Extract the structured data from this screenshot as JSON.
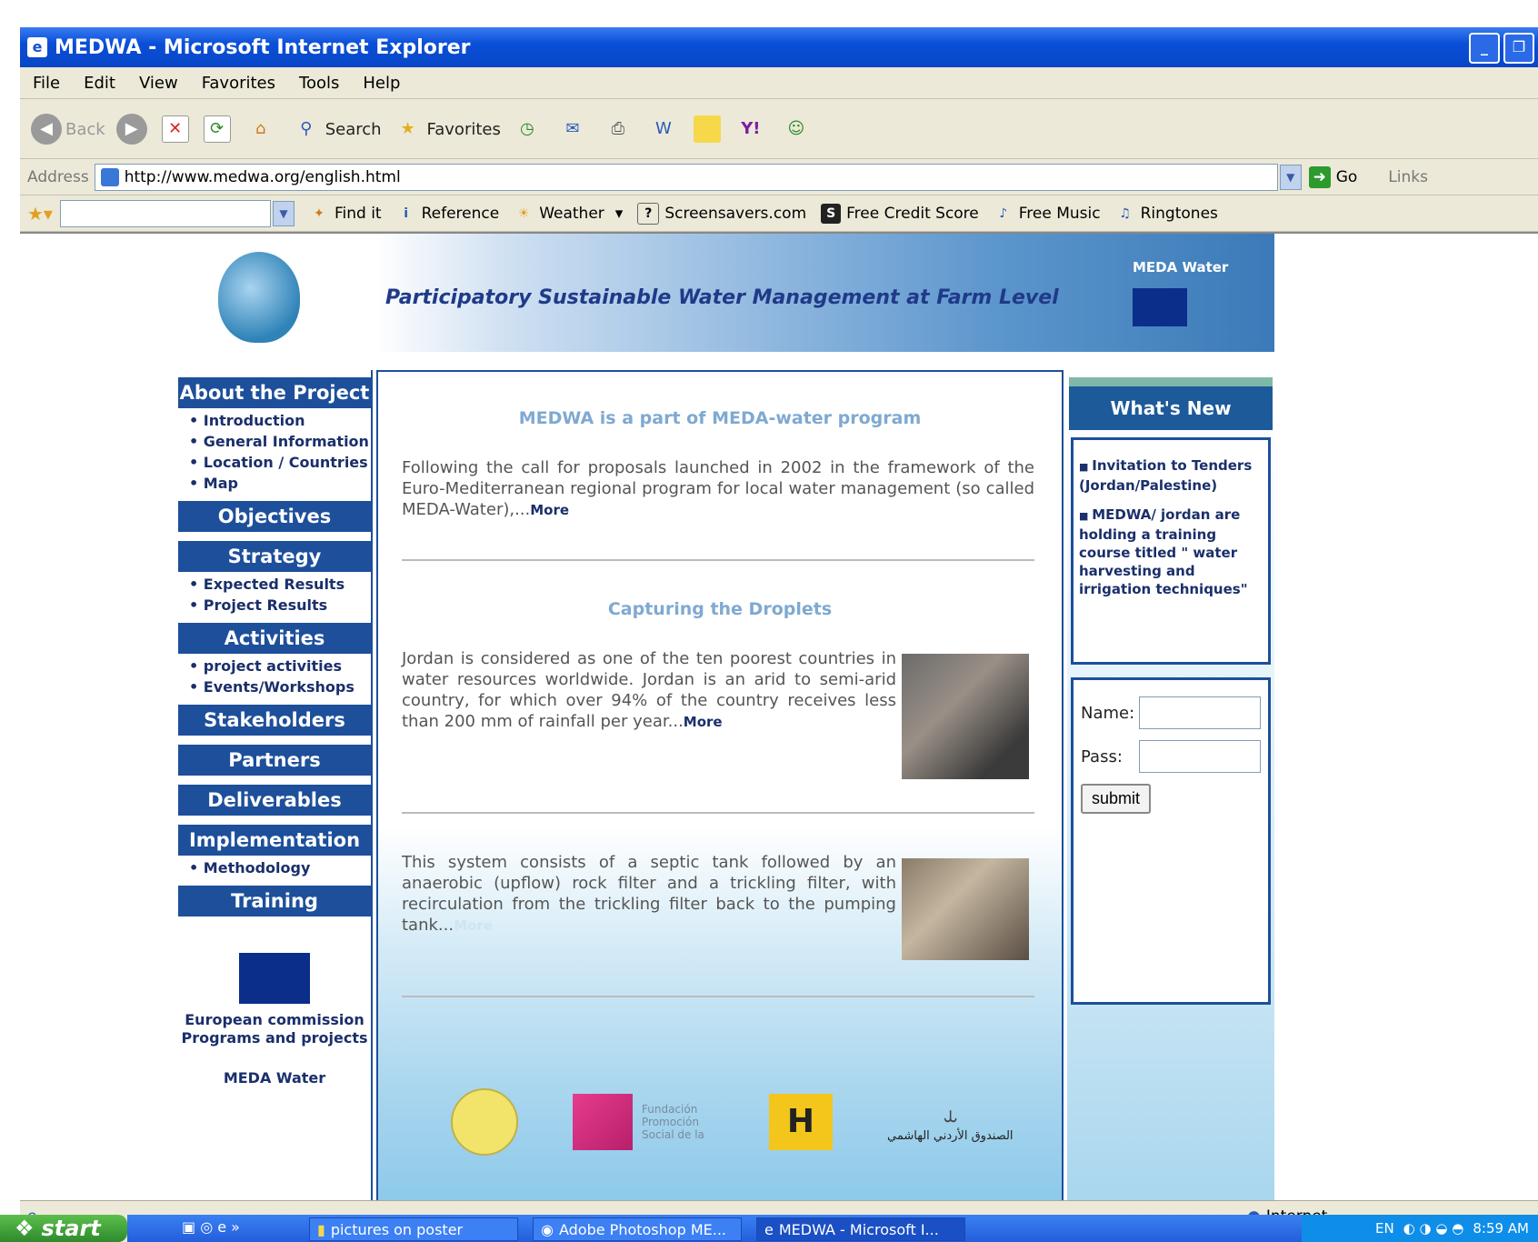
{
  "window": {
    "title": "MEDWA - Microsoft Internet Explorer"
  },
  "menu": [
    "File",
    "Edit",
    "View",
    "Favorites",
    "Tools",
    "Help"
  ],
  "toolbar": {
    "back": "Back",
    "search": "Search",
    "favorites": "Favorites"
  },
  "address": {
    "label": "Address",
    "url": "http://www.medwa.org/english.html",
    "go": "Go",
    "links": "Links"
  },
  "links_bar": {
    "items": [
      "Find it",
      "Reference",
      "Weather",
      "Screensavers.com",
      "Free Credit Score",
      "Free Music",
      "Ringtones"
    ]
  },
  "banner": {
    "tagline": "Participatory Sustainable Water Management at Farm Level",
    "brand": "MEDA Water"
  },
  "sidebar": {
    "sections": [
      {
        "label": "About the Project",
        "subs": [
          "Introduction",
          "General Information",
          "Location / Countries",
          "Map"
        ]
      },
      {
        "label": "Objectives",
        "subs": []
      },
      {
        "label": "Strategy",
        "subs": [
          "Expected Results",
          "Project Results"
        ]
      },
      {
        "label": "Activities",
        "subs": [
          "project activities",
          "Events/Workshops"
        ]
      },
      {
        "label": "Stakeholders",
        "subs": []
      },
      {
        "label": "Partners",
        "subs": []
      },
      {
        "label": "Deliverables",
        "subs": []
      },
      {
        "label": "Implementation",
        "subs": [
          "Methodology"
        ]
      },
      {
        "label": "Training",
        "subs": []
      }
    ],
    "eu_text_1": "European commission",
    "eu_text_2": "Programs and projects",
    "meda_text": "MEDA Water"
  },
  "content": {
    "section1_title": "MEDWA is a part of MEDA-water program",
    "section1_text": "Following the call for proposals launched in 2002 in the framework of the Euro-Mediterranean regional program for local water management (so called MEDA-Water),...",
    "section2_title": "Capturing the Droplets",
    "section2_text": "Jordan is considered as one of the ten poorest countries in water resources worldwide. Jordan is an arid to semi-arid country, for which over 94% of the country receives less than 200 mm of rainfall per year...",
    "section3_text": "This system consists of a septic tank followed by an anaerobic (upflow) rock filter and a trickling filter, with recirculation from the trickling filter back to the pumping tank...",
    "more": "More",
    "logo2_text": "Fundación Promoción Social de la",
    "logo4_text": "الصندوق الأردني الهاشمي"
  },
  "whats_new": {
    "title": "What's New",
    "items": [
      "Invitation to Tenders (Jordan/Palestine)",
      "MEDWA/ jordan are holding a training course titled \" water harvesting and irrigation techniques\""
    ]
  },
  "login": {
    "name_label": "Name:",
    "pass_label": "Pass:",
    "submit": "submit"
  },
  "status": {
    "zone": "Internet"
  },
  "taskbar": {
    "start": "start",
    "tasks": [
      "pictures on poster",
      "Adobe Photoshop ME...",
      "MEDWA - Microsoft I..."
    ],
    "lang": "EN",
    "time": "8:59 AM"
  }
}
